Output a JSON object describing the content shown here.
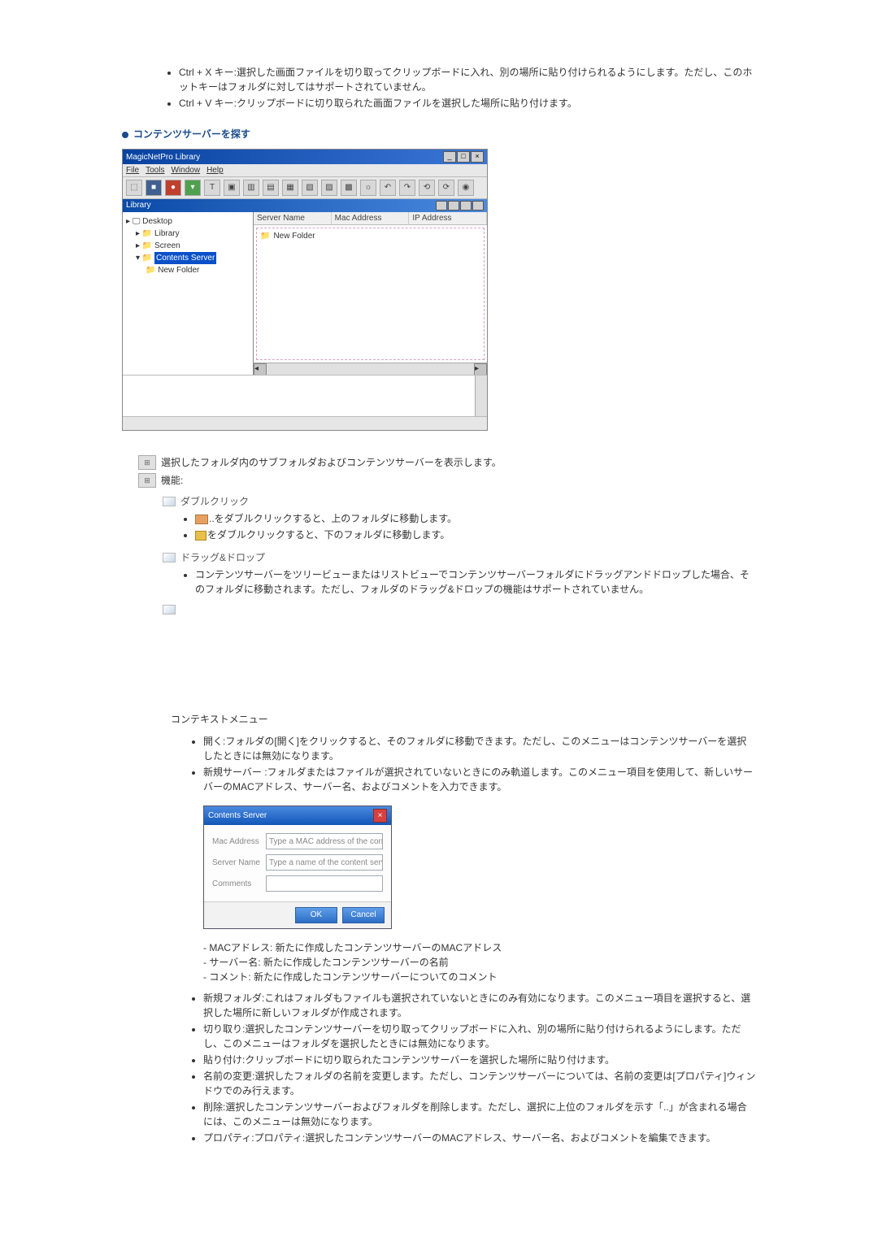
{
  "top_bullets": [
    "Ctrl + X キー:選択した画面ファイルを切り取ってクリップボードに入れ、別の場所に貼り付けられるようにします。ただし、このホットキーはフォルダに対してはサポートされていません。",
    "Ctrl + V キー:クリップボードに切り取られた画面ファイルを選択した場所に貼り付けます。"
  ],
  "section_title": "コンテンツサーバーを探す",
  "app_window": {
    "title": "MagicNetPro Library",
    "menus": [
      "File",
      "Tools",
      "Window",
      "Help"
    ],
    "panel_title": "Library",
    "tree": {
      "items": [
        {
          "label": "Desktop",
          "indent": 0
        },
        {
          "label": "Library",
          "indent": 1
        },
        {
          "label": "Screen",
          "indent": 1
        },
        {
          "label": "Contents Server",
          "indent": 1,
          "selected": true
        },
        {
          "label": "New Folder",
          "indent": 2
        }
      ]
    },
    "list_columns": [
      "Server Name",
      "Mac Address",
      "IP Address"
    ],
    "list_row": {
      "name": "New Folder"
    }
  },
  "def1": "選択したフォルダ内のサブフォルダおよびコンテンツサーバーを表示します。",
  "def2_label": "機能:",
  "subs": {
    "dblclick": "ダブルクリック",
    "dblclick_items": [
      "をダブルクリックすると、上のフォルダに移動します。",
      "をダブルクリックすると、下のフォルダに移動します。"
    ],
    "dragdrop": "ドラッグ&ドロップ",
    "dragdrop_items": [
      "コンテンツサーバーをツリービューまたはリストビューでコンテンツサーバーフォルダにドラッグアンドドロップした場合、そのフォルダに移動されます。ただし、フォルダのドラッグ&ドロップの機能はサポートされていません。"
    ]
  },
  "ctx_heading": "コンテキストメニュー",
  "ctx_items_top": [
    "開く:フォルダの[開く]をクリックすると、そのフォルダに移動できます。ただし、このメニューはコンテンツサーバーを選択したときには無効になります。",
    "新規サーバー :フォルダまたはファイルが選択されていないときにのみ軌道します。このメニュー項目を使用して、新しいサーバーのMACアドレス、サーバー名、およびコメントを入力できます。"
  ],
  "dialog": {
    "title": "Contents Server",
    "fields": {
      "mac_label": "Mac Address",
      "mac_placeholder": "Type a MAC address of the content server.",
      "name_label": "Server Name",
      "name_placeholder": "Type a name of the content server.",
      "comment_label": "Comments"
    },
    "buttons": {
      "ok": "OK",
      "cancel": "Cancel"
    }
  },
  "notes": [
    "- MACアドレス:  新たに作成したコンテンツサーバーのMACアドレス",
    "- サーバー名:  新たに作成したコンテンツサーバーの名前",
    "- コメント:  新たに作成したコンテンツサーバーについてのコメント"
  ],
  "ctx_items_bottom": [
    "新規フォルダ:これはフォルダもファイルも選択されていないときにのみ有効になります。このメニュー項目を選択すると、選択した場所に新しいフォルダが作成されます。",
    "切り取り:選択したコンテンツサーバーを切り取ってクリップボードに入れ、別の場所に貼り付けられるようにします。ただし、このメニューはフォルダを選択したときには無効になります。",
    "貼り付け:クリップボードに切り取られたコンテンツサーバーを選択した場所に貼り付けます。",
    "名前の変更:選択したフォルダの名前を変更します。ただし、コンテンツサーバーについては、名前の変更は[プロパティ]ウィンドウでのみ行えます。",
    "削除:選択したコンテンツサーバーおよびフォルダを削除します。ただし、選択に上位のフォルダを示す「..」が含まれる場合には、このメニューは無効になります。",
    "プロパティ:プロパティ:選択したコンテンツサーバーのMACアドレス、サーバー名、およびコメントを編集できます。"
  ]
}
